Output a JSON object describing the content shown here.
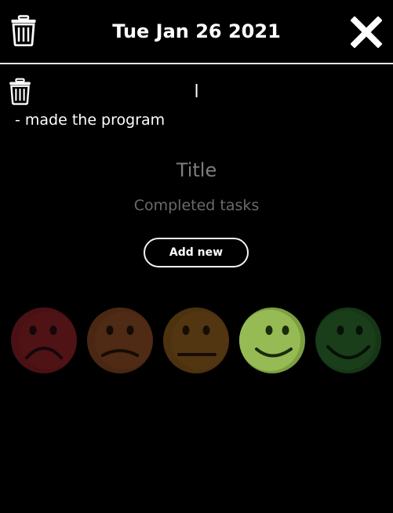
{
  "header": {
    "date_title": "Tue Jan 26 2021",
    "delete_icon": "trash-icon",
    "close_icon": "close-icon"
  },
  "entry": {
    "title": "l",
    "task": "- made the program",
    "delete_icon": "trash-icon"
  },
  "form": {
    "title_placeholder": "Title",
    "tasks_placeholder": "Completed tasks",
    "add_button_label": "Add new"
  },
  "moods": [
    {
      "icon": "very-sad-face-icon",
      "color": "#4a1114"
    },
    {
      "icon": "sad-face-icon",
      "color": "#4a2713"
    },
    {
      "icon": "neutral-face-icon",
      "color": "#4d3210"
    },
    {
      "icon": "happy-face-icon",
      "color": "#8bb04a"
    },
    {
      "icon": "very-happy-face-icon",
      "color": "#163716"
    }
  ]
}
